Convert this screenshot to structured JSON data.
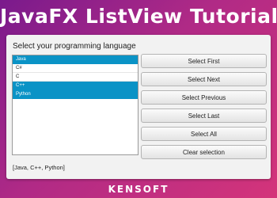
{
  "banner": {
    "title": "JavaFX ListView Tutorial"
  },
  "window": {
    "prompt": "Select your programming language",
    "list_items": [
      {
        "label": "Java",
        "selected": true
      },
      {
        "label": "C#",
        "selected": false
      },
      {
        "label": "C",
        "selected": false
      },
      {
        "label": "C++",
        "selected": true
      },
      {
        "label": "Python",
        "selected": true
      }
    ],
    "buttons": [
      {
        "label": "Select First"
      },
      {
        "label": "Select Next"
      },
      {
        "label": "Select Previous"
      },
      {
        "label": "Select Last"
      },
      {
        "label": "Select All"
      },
      {
        "label": "Clear selection"
      }
    ],
    "output": "[Java, C++, Python]"
  },
  "brand": {
    "name": "KENSOFT"
  },
  "colors": {
    "selection": "#0a93c6",
    "background_start": "#7a1a8c",
    "background_end": "#d4347a"
  }
}
